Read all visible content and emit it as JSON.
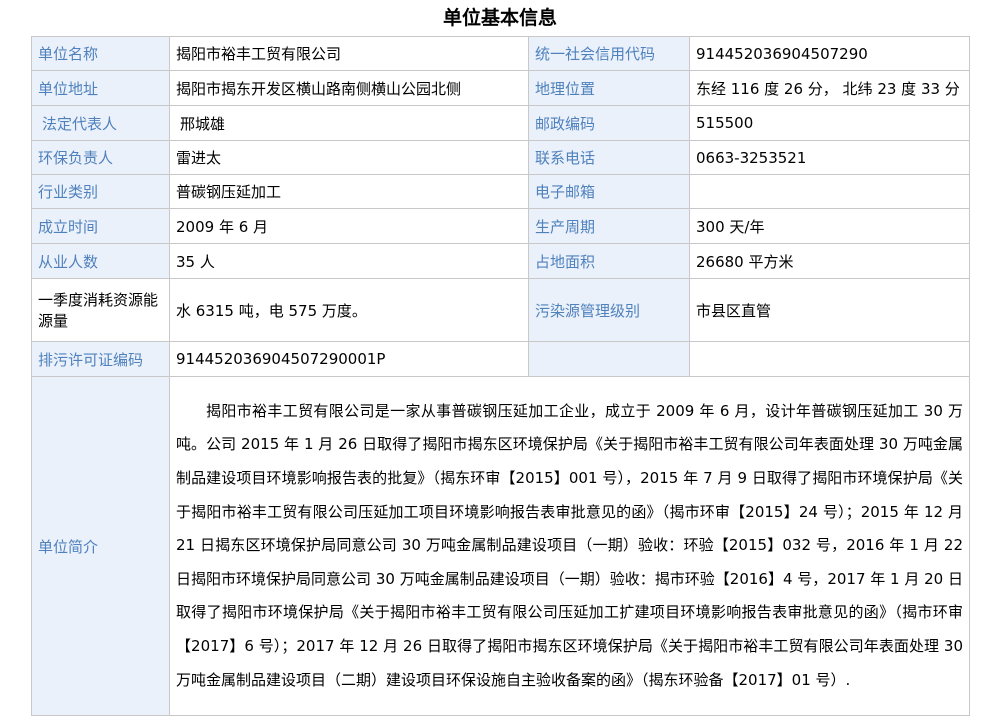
{
  "title": "单位基本信息",
  "rows": [
    {
      "l1": "单位名称",
      "v1": "揭阳市裕丰工贸有限公司",
      "l2": "统一社会信用代码",
      "v2": "914452036904507290"
    },
    {
      "l1": "单位地址",
      "v1": "揭阳市揭东开发区横山路南侧横山公园北侧",
      "l2": "地理位置",
      "v2": "东经 116 度 26 分， 北纬 23 度 33 分"
    },
    {
      "l1": "法定代表人",
      "v1": "邢城雄",
      "l2": "邮政编码",
      "v2": "515500"
    },
    {
      "l1": "环保负责人",
      "v1": "雷进太",
      "l2": "联系电话",
      "v2": "0663-3253521"
    },
    {
      "l1": "行业类别",
      "v1": "普碳钢压延加工",
      "l2": "电子邮箱",
      "v2": ""
    },
    {
      "l1": "成立时间",
      "v1": "2009 年 6 月",
      "l2": "生产周期",
      "v2": "300 天/年"
    },
    {
      "l1": "从业人数",
      "v1": "35 人",
      "l2": "占地面积",
      "v2": "26680 平方米"
    },
    {
      "l1": "一季度消耗资源能源量",
      "v1": "水 6315 吨，电 575 万度。",
      "l2": "污染源管理级别",
      "v2": "市县区直管"
    },
    {
      "l1": "排污许可证编码",
      "v1": "914452036904507290001P",
      "l2": "",
      "v2": ""
    }
  ],
  "intro": {
    "label": "单位简介",
    "text": "揭阳市裕丰工贸有限公司是一家从事普碳钢压延加工企业，成立于 2009 年 6 月，设计年普碳钢压延加工 30 万吨。公司 2015 年 1 月 26 日取得了揭阳市揭东区环境保护局《关于揭阳市裕丰工贸有限公司年表面处理 30 万吨金属制品建设项目环境影响报告表的批复》（揭东环审【2015】001 号），2015 年 7 月 9 日取得了揭阳市环境保护局《关于揭阳市裕丰工贸有限公司压延加工项目环境影响报告表审批意见的函》（揭市环审【2015】24 号）；2015 年 12 月 21 日揭东区环境保护局同意公司 30 万吨金属制品建设项目（一期）验收：环验【2015】032 号，2016 年 1 月 22 日揭阳市环境保护局同意公司 30 万吨金属制品建设项目（一期）验收：揭市环验【2016】4 号，2017 年 1 月 20 日取得了揭阳市环境保护局《关于揭阳市裕丰工贸有限公司压延加工扩建项目环境影响报告表审批意见的函》（揭市环审【2017】6 号）；2017 年 12 月 26 日取得了揭阳市揭东区环境保护局《关于揭阳市裕丰工贸有限公司年表面处理 30 万吨金属制品建设项目（二期）建设项目环保设施自主验收备案的函》（揭东环验备【2017】01 号）."
  }
}
